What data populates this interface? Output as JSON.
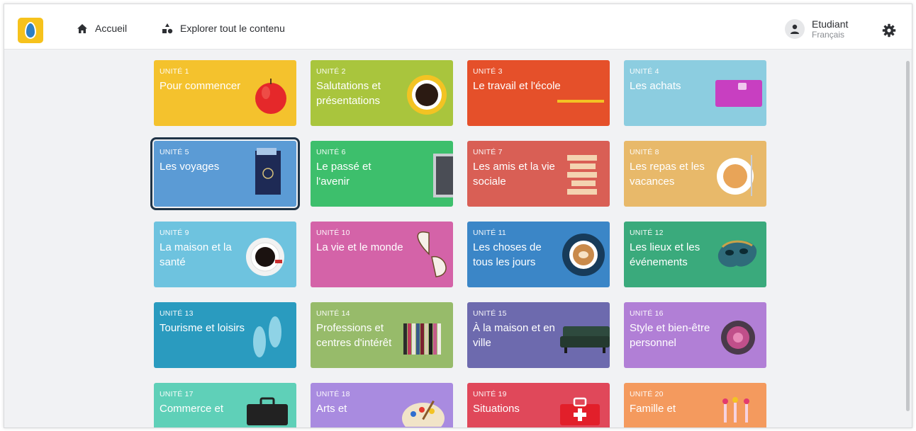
{
  "header": {
    "nav": [
      {
        "label": "Accueil",
        "icon": "home-icon"
      },
      {
        "label": "Explorer tout le contenu",
        "icon": "explore-icon"
      }
    ],
    "user": {
      "name": "Etudiant",
      "language": "Français"
    },
    "settings_icon": "gear-icon"
  },
  "units": [
    {
      "unit": "UNITÉ 1",
      "title": "Pour commencer",
      "color": "#f4c22d",
      "icon": "apple-icon"
    },
    {
      "unit": "UNITÉ 2",
      "title": "Salutations et présentations",
      "color": "#a9c53d",
      "icon": "coffee-cup-icon"
    },
    {
      "unit": "UNITÉ 3",
      "title": "Le travail et l'école",
      "color": "#e5502a",
      "icon": "pencil-icon"
    },
    {
      "unit": "UNITÉ 4",
      "title": "Les achats",
      "color": "#8ccde0",
      "icon": "wallet-icon"
    },
    {
      "unit": "UNITÉ 5",
      "title": "Les voyages",
      "color": "#5b9bd5",
      "icon": "passport-icon",
      "selected": true
    },
    {
      "unit": "UNITÉ 6",
      "title": "Le passé et l'avenir",
      "color": "#3dbf6c",
      "icon": "laptop-icon"
    },
    {
      "unit": "UNITÉ 7",
      "title": "Les amis et la vie sociale",
      "color": "#d95f55",
      "icon": "jenga-icon"
    },
    {
      "unit": "UNITÉ 8",
      "title": "Les repas et les vacances",
      "color": "#e8b96a",
      "icon": "plate-icon"
    },
    {
      "unit": "UNITÉ 9",
      "title": "La maison et la santé",
      "color": "#6ec3df",
      "icon": "espresso-icon"
    },
    {
      "unit": "UNITÉ 10",
      "title": "La vie et le monde",
      "color": "#d463a8",
      "icon": "butterfly-icon"
    },
    {
      "unit": "UNITÉ 11",
      "title": "Les choses de tous les jours",
      "color": "#3b86c7",
      "icon": "latte-icon"
    },
    {
      "unit": "UNITÉ 12",
      "title": "Les lieux et les événements",
      "color": "#3aaa7c",
      "icon": "mask-icon"
    },
    {
      "unit": "UNITÉ 13",
      "title": "Tourisme et loisirs",
      "color": "#2a9bbf",
      "icon": "flip-flops-icon"
    },
    {
      "unit": "UNITÉ 14",
      "title": "Professions et centres d'intérêt",
      "color": "#97bb6a",
      "icon": "books-icon"
    },
    {
      "unit": "UNITÉ 15",
      "title": "À la maison et en ville",
      "color": "#6d6aae",
      "icon": "sofa-icon"
    },
    {
      "unit": "UNITÉ 16",
      "title": "Style et bien-être personnel",
      "color": "#b17fd6",
      "icon": "flower-icon"
    },
    {
      "unit": "UNITÉ 17",
      "title": "Commerce et",
      "color": "#5fd0b8",
      "icon": "briefcase-icon"
    },
    {
      "unit": "UNITÉ 18",
      "title": "Arts et",
      "color": "#a98be0",
      "icon": "palette-icon"
    },
    {
      "unit": "UNITÉ 19",
      "title": "Situations",
      "color": "#e0485a",
      "icon": "first-aid-icon"
    },
    {
      "unit": "UNITÉ 20",
      "title": "Famille et",
      "color": "#f49a5e",
      "icon": "vase-icon"
    }
  ]
}
